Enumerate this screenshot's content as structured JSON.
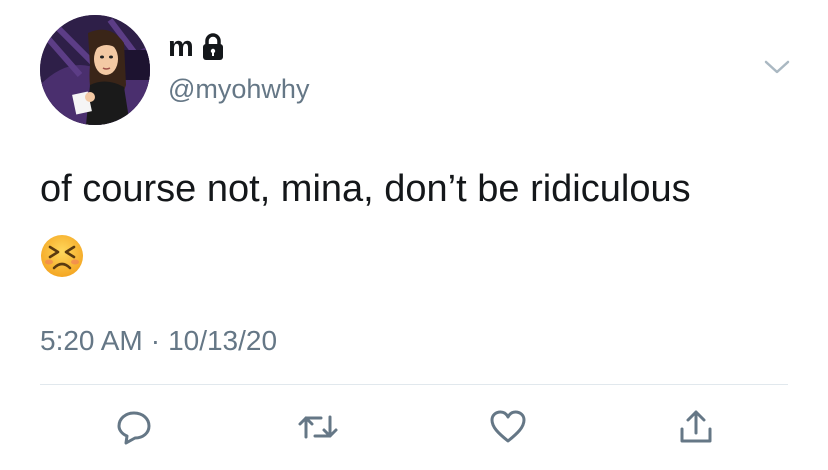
{
  "user": {
    "display_name": "m",
    "handle": "@myohwhy",
    "protected_icon": "lock-icon",
    "avatar_icon": "cartoon-character-avatar"
  },
  "tweet": {
    "text": "of course not, mina, don’t be ridiculous",
    "emoji": "😣",
    "time": "5:20 AM",
    "separator": "·",
    "date": "10/13/20"
  },
  "actions": [
    {
      "name": "reply",
      "icon": "reply-icon"
    },
    {
      "name": "retweet",
      "icon": "retweet-icon"
    },
    {
      "name": "like",
      "icon": "heart-icon"
    },
    {
      "name": "share",
      "icon": "share-icon"
    }
  ],
  "colors": {
    "text_primary": "#14171a",
    "text_secondary": "#657786",
    "icon": "#657786",
    "divider": "#e1e8ed"
  }
}
